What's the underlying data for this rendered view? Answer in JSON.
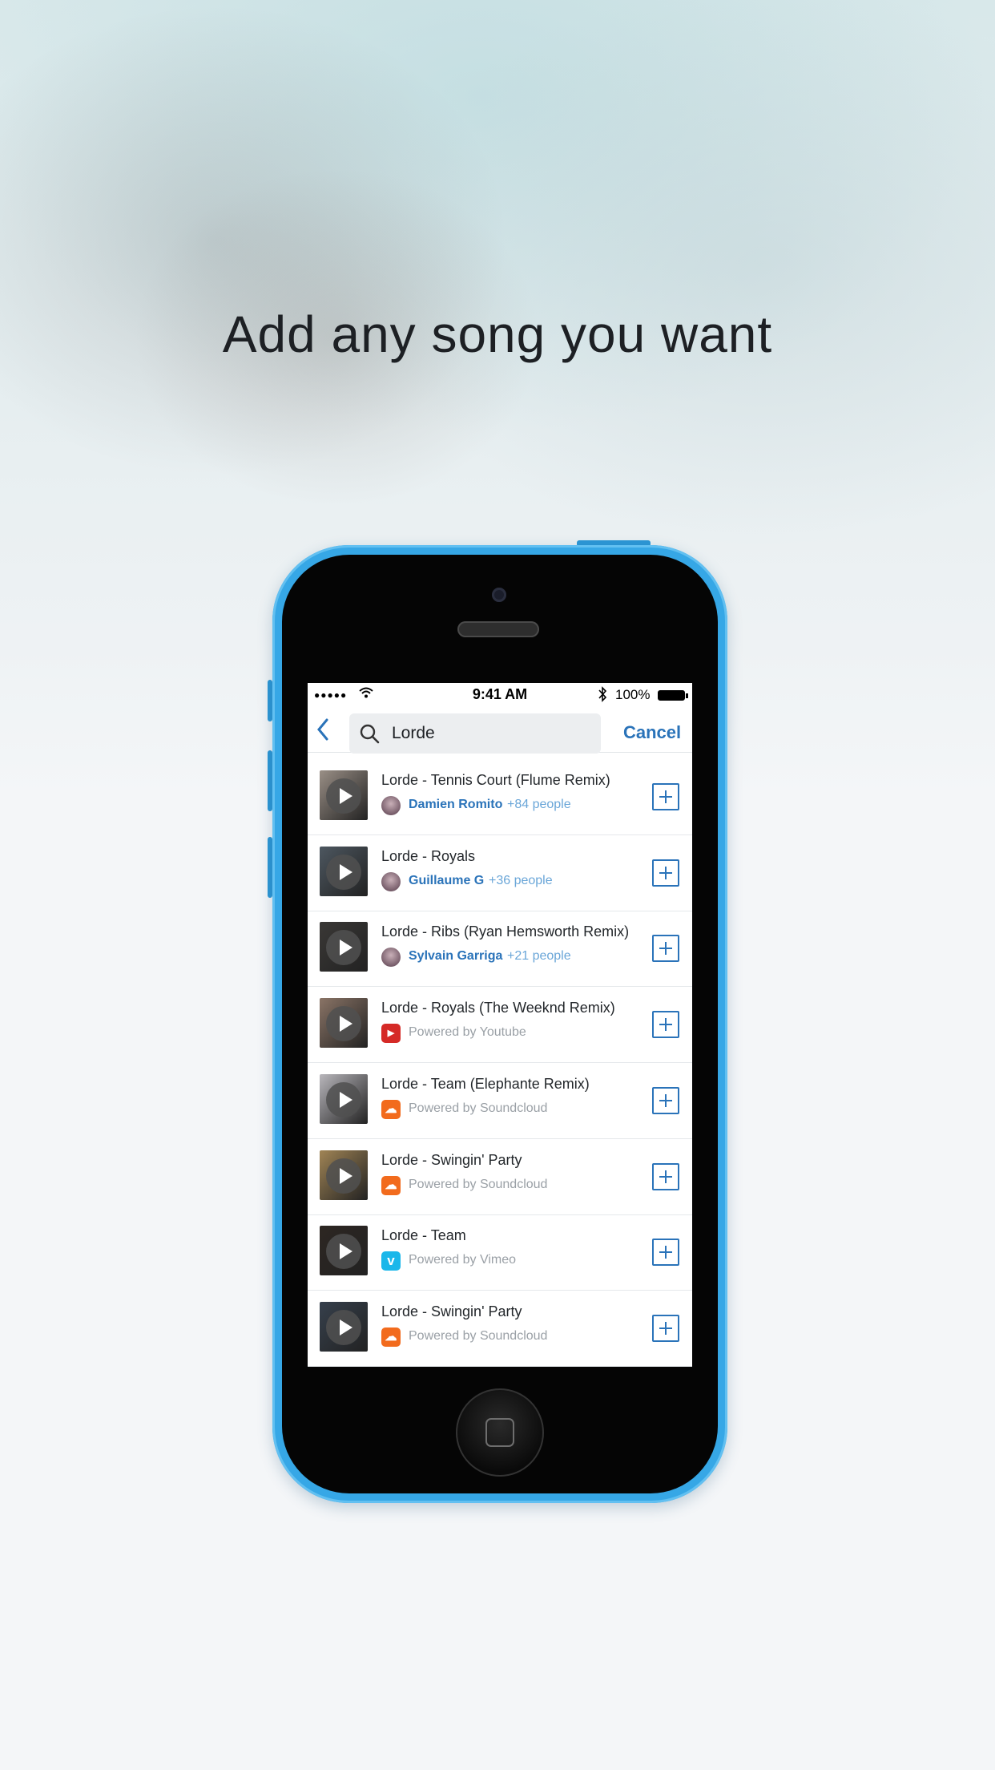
{
  "headline": "Add any song you want",
  "status_bar": {
    "signal": "●●●●●",
    "time": "9:41 AM",
    "battery": "100%"
  },
  "search": {
    "query": "Lorde",
    "cancel_label": "Cancel"
  },
  "colors": {
    "accent": "#2a73b9",
    "phone_body": "#36a7e6",
    "youtube": "#d52a27",
    "soundcloud": "#f26b1d",
    "vimeo": "#1ab7ea"
  },
  "results": [
    {
      "title": "Lorde - Tennis Court (Flume Remix)",
      "user": "Damien Romito",
      "people": "+84 people",
      "source_icon": "avatar",
      "thumb_color": "#9a8f86"
    },
    {
      "title": "Lorde - Royals",
      "user": "Guillaume G",
      "people": "+36 people",
      "source_icon": "avatar",
      "thumb_color": "#4d5760"
    },
    {
      "title": "Lorde - Ribs (Ryan Hemsworth Remix)",
      "user": "Sylvain Garriga",
      "people": "+21 people",
      "source_icon": "avatar",
      "thumb_color": "#3a3836"
    },
    {
      "title": "Lorde - Royals (The Weeknd Remix)",
      "powered": "Powered by Youtube",
      "source_icon": "youtube-icon",
      "thumb_color": "#8a7466"
    },
    {
      "title": "Lorde - Team (Elephante Remix)",
      "powered": "Powered by Soundcloud",
      "source_icon": "soundcloud-icon",
      "thumb_color": "#b8b6bb"
    },
    {
      "title": "Lorde - Swingin' Party",
      "powered": "Powered by Soundcloud",
      "source_icon": "soundcloud-icon",
      "thumb_color": "#a08455"
    },
    {
      "title": "Lorde - Team",
      "powered": "Powered by Vimeo",
      "source_icon": "vimeo-icon",
      "thumb_color": "#2d2622"
    },
    {
      "title": "Lorde - Swingin' Party",
      "powered": "Powered by Soundcloud",
      "source_icon": "soundcloud-icon",
      "thumb_color": "#36404c"
    }
  ]
}
